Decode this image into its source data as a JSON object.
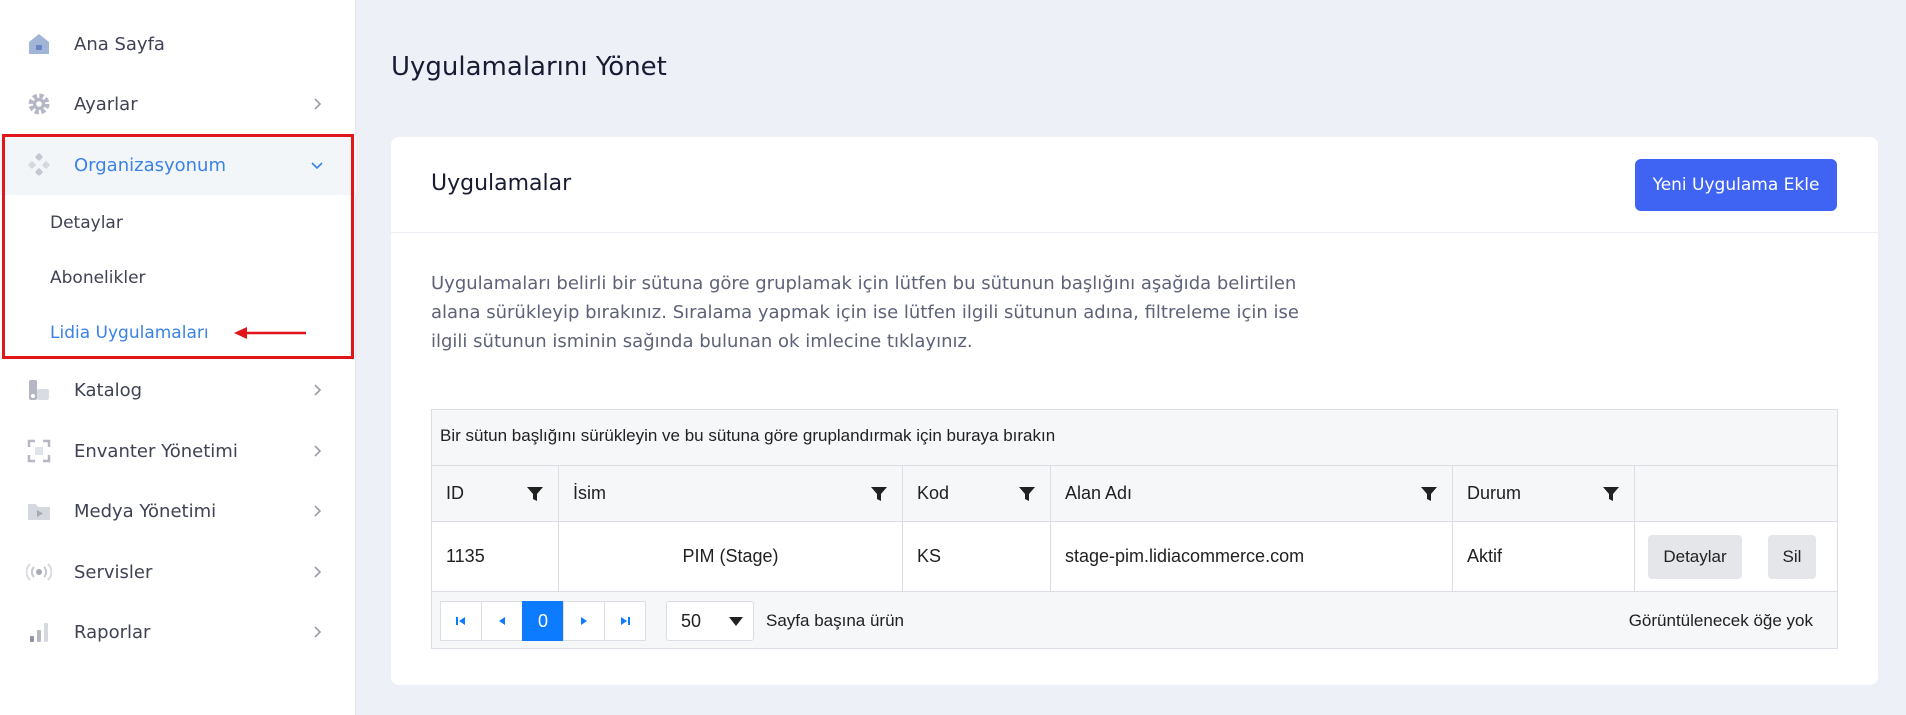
{
  "sidebar": {
    "items": [
      {
        "label": "Ana Sayfa",
        "icon": "home-icon"
      },
      {
        "label": "Ayarlar",
        "icon": "gear-icon"
      },
      {
        "label": "Organizasyonum",
        "icon": "organization-icon"
      },
      {
        "label": "Katalog",
        "icon": "catalog-icon"
      },
      {
        "label": "Envanter Yönetimi",
        "icon": "inventory-icon"
      },
      {
        "label": "Medya Yönetimi",
        "icon": "media-folder-icon"
      },
      {
        "label": "Servisler",
        "icon": "broadcast-icon"
      },
      {
        "label": "Raporlar",
        "icon": "bar-chart-icon"
      }
    ],
    "sub_items": [
      {
        "label": "Detaylar"
      },
      {
        "label": "Abonelikler"
      },
      {
        "label": "Lidia Uygulamaları"
      }
    ]
  },
  "page": {
    "title": "Uygulamalarını Yönet"
  },
  "card": {
    "title": "Uygulamalar",
    "add_button": "Yeni Uygulama Ekle",
    "description": "Uygulamaları belirli bir sütuna göre gruplamak için lütfen bu sütunun başlığını aşağıda belirtilen alana sürükleyip bırakınız. Sıralama yapmak için ise lütfen ilgili sütunun adına, filtreleme için ise ilgili sütunun isminin sağında bulunan ok imlecine tıklayınız."
  },
  "grid": {
    "group_panel": "Bir sütun başlığını sürükleyin ve bu sütuna göre gruplandırmak için buraya bırakın",
    "columns": [
      "ID",
      "İsim",
      "Kod",
      "Alan Adı",
      "Durum"
    ],
    "rows": [
      {
        "id": "1135",
        "name": "PIM (Stage)",
        "code": "KS",
        "domain": "stage-pim.lidiacommerce.com",
        "status": "Aktif",
        "details": "Detaylar",
        "delete": "Sil"
      }
    ],
    "pager": {
      "current_page": "0",
      "page_size": "50",
      "page_size_label": "Sayfa başına ürün",
      "info": "Görüntülenecek öğe yok"
    }
  },
  "colors": {
    "accent": "#3b82e6",
    "primary_button": "#3f63f3",
    "pager_active": "#0d7bff",
    "highlight": "#e0161a"
  }
}
